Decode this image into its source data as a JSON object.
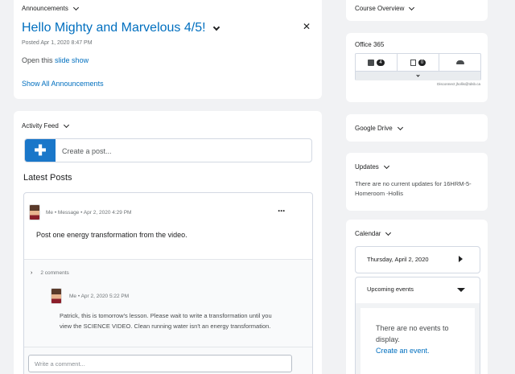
{
  "announcements": {
    "widget_title": "Announcements",
    "headline": "Hello Mighty and Marvelous 4/5!",
    "posted": "Posted Apr 1, 2020 8:47 PM",
    "body_prefix": "Open this",
    "body_link": "slide show",
    "show_all": "Show All Announcements"
  },
  "activity": {
    "widget_title": "Activity Feed",
    "create_placeholder": "Create a post...",
    "latest_heading": "Latest Posts",
    "post": {
      "author": "Me",
      "type": "Message",
      "date": "Apr 2, 2020 4:29 PM",
      "body": "Post one energy transformation from the video.",
      "comments_count": "2 comments",
      "comment": {
        "author": "Me",
        "date": "Apr 2, 2020 5:22 PM",
        "body": "Patrick, this is tomorrow's lesson. Please wait to write a transformation until you view the SCIENCE VIDEO. Clean running water isn't an energy transformation."
      },
      "comment_placeholder": "Write a comment..."
    }
  },
  "course_overview": {
    "title": "Course Overview"
  },
  "office365": {
    "title": "Office 365",
    "outlook_count": "4",
    "calendar_count": "0",
    "disconnect": "Disconnect jhollis@tdsb.ca"
  },
  "google_drive": {
    "title": "Google Drive"
  },
  "updates": {
    "title": "Updates",
    "message": "There are no current updates for 16HRM-5-Homeroom -Hollis"
  },
  "calendar": {
    "title": "Calendar",
    "date": "Thursday, April 2, 2020",
    "upcoming": "Upcoming events",
    "no_events": "There are no events to display.",
    "create_link": "Create an event."
  },
  "colors": {
    "accent": "#006fbf",
    "brand_button": "#1a77c9"
  }
}
